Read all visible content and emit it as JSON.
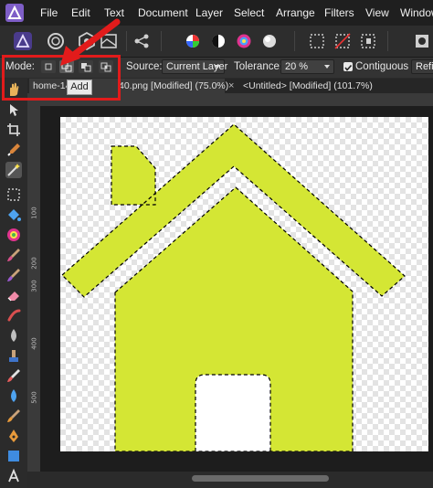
{
  "menu": {
    "file": "File",
    "edit": "Edit",
    "text": "Text",
    "document": "Document",
    "layer": "Layer",
    "select": "Select",
    "arrange": "Arrange",
    "filters": "Filters",
    "view": "View",
    "window": "Window"
  },
  "context_toolbar": {
    "mode_label": "Mode:",
    "source_label": "Source:",
    "source_value": "Current Layer",
    "tolerance_label": "Tolerance:",
    "tolerance_value": "20 %",
    "contiguous_label": "Contiguous",
    "contiguous_checked": true,
    "refine_label": "Refi",
    "active_mode": "add"
  },
  "tooltip": {
    "text": "Add"
  },
  "tabs": [
    {
      "label": "home-14",
      "label_tail": "40.png [Modified] (75.0%)",
      "active": true
    },
    {
      "label": "<Untitled> [Modified] (101.7%)",
      "active": false
    }
  ],
  "rulers": {
    "vertical_labels": [
      "100",
      "200",
      "300",
      "400",
      "500"
    ]
  },
  "colors": {
    "accent_highlight": "#e21b1b",
    "shape_fill": "#d4e634",
    "arrow": "#e21b1b"
  },
  "tools": [
    "view-icon",
    "move-icon",
    "crop-icon",
    "paint-brush-icon",
    "magic-wand-icon",
    "flood-select-icon",
    "fill-icon",
    "color-picker-icon",
    "brush-icon",
    "eraser-icon",
    "smudge-icon",
    "blur-icon",
    "clone-icon",
    "burn-icon",
    "drop-icon",
    "dodge-icon",
    "pen-icon",
    "shape-icon",
    "text-icon"
  ]
}
